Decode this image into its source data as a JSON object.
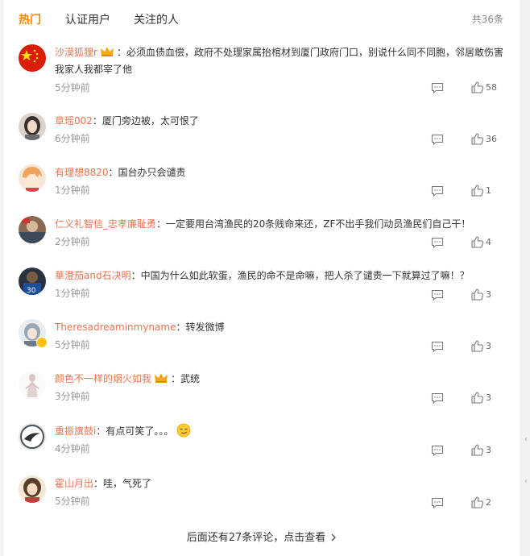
{
  "tabs": [
    {
      "label": "热门",
      "active": true
    },
    {
      "label": "认证用户",
      "active": false
    },
    {
      "label": "关注的人",
      "active": false
    }
  ],
  "total_count": "共36条",
  "comments": [
    {
      "user": "沙漠狐狸r",
      "text": "：必须血债血偿，政府不处理家属抬棺材到厦门政府门口，别说什么同不同胞，邻居敢伤害我家人我都宰了他",
      "time": "5分钟前",
      "likes": "58"
    },
    {
      "user": "章瑶002",
      "text": "：厦门旁边被，太可恨了",
      "time": "6分钟前",
      "likes": "36"
    },
    {
      "user": "有理想8820",
      "text": "：国台办只会谴责",
      "time": "1分钟前",
      "likes": "1"
    },
    {
      "user": "仁义礼智信_忠孝廉耻勇",
      "text": "：一定要用台湾渔民的20条贱命来还，ZF不出手我们动员渔民们自己干！",
      "time": "2分钟前",
      "likes": "4"
    },
    {
      "user": "華澄茄and石决明",
      "text": "：中国为什么如此软蛋，渔民的命不是命嘛，把人杀了谴责一下就算过了嘛！？",
      "time": "1分钟前",
      "likes": "3"
    },
    {
      "user": "Theresadreaminmyname",
      "text": "：转发微博",
      "time": "5分钟前",
      "likes": "3"
    },
    {
      "user": "颜色不一样的烟火如我",
      "text": "：武统",
      "time": "3分钟前",
      "likes": "3"
    },
    {
      "user": "重振旗鼓i",
      "text": "：有点可笑了。。。",
      "time": "4分钟前",
      "likes": "3"
    },
    {
      "user": "霍山月出",
      "text": "：哇，气死了",
      "time": "5分钟前",
      "likes": "2"
    }
  ],
  "more_label": "后面还有27条评论，点击查看",
  "icons": {
    "reply": "comment-icon",
    "like": "thumbs-up-icon",
    "crown": "crown-badge-icon",
    "verified": "verified-badge-icon",
    "emoji": "smirk-emoji-icon",
    "more": "chevron-right-icon"
  },
  "colors": {
    "accent": "#ff8200",
    "username": "#eb7350",
    "meta": "#999999"
  }
}
